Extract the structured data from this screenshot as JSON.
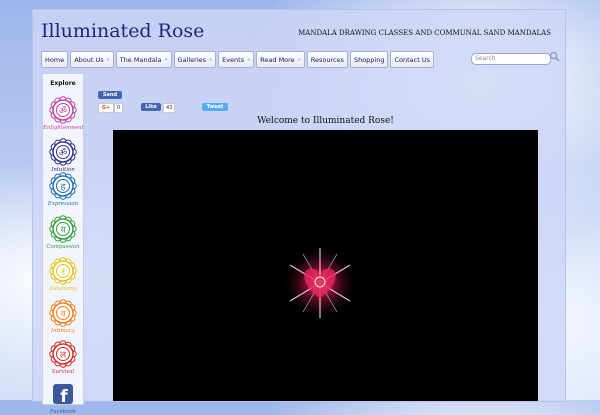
{
  "site": {
    "title": "Illuminated Rose",
    "tagline": "MANDALA DRAWING CLASSES AND COMMUNAL SAND MANDALAS"
  },
  "nav": {
    "items": [
      {
        "label": "Home",
        "has_dropdown": false
      },
      {
        "label": "About Us",
        "has_dropdown": true
      },
      {
        "label": "The Mandala",
        "has_dropdown": true
      },
      {
        "label": "Galleries",
        "has_dropdown": true
      },
      {
        "label": "Events",
        "has_dropdown": true
      },
      {
        "label": "Read More",
        "has_dropdown": true
      },
      {
        "label": "Resources",
        "has_dropdown": false
      },
      {
        "label": "Shopping",
        "has_dropdown": false
      },
      {
        "label": "Contact Us",
        "has_dropdown": false
      }
    ],
    "dropdown_glyph": "»"
  },
  "search": {
    "placeholder": "Search",
    "icon": "search-icon"
  },
  "sidebar": {
    "heading": "Explore",
    "items": [
      {
        "label": "Enlightenment",
        "color": "#c23fa8",
        "icon": "crown-chakra-icon",
        "glyph": "ॐ"
      },
      {
        "label": "Intuition",
        "color": "#2e3192",
        "icon": "third-eye-chakra-icon",
        "glyph": "ॐ"
      },
      {
        "label": "Expression",
        "color": "#1b6fb5",
        "icon": "throat-chakra-icon",
        "glyph": "ह"
      },
      {
        "label": "Compassion",
        "color": "#2f9e3c",
        "icon": "heart-chakra-icon",
        "glyph": "य"
      },
      {
        "label": "Autonomy",
        "color": "#e0c21a",
        "icon": "solar-plexus-chakra-icon",
        "glyph": "र"
      },
      {
        "label": "Intimacy",
        "color": "#ef7d1a",
        "icon": "sacral-chakra-icon",
        "glyph": "व"
      },
      {
        "label": "Survival",
        "color": "#d42a2a",
        "icon": "root-chakra-icon",
        "glyph": "ल"
      },
      {
        "label": "Facebook",
        "color": "#3b5998",
        "icon": "facebook-icon",
        "glyph": "f"
      }
    ]
  },
  "social": {
    "send_label": "Send",
    "gplus_label": "G+",
    "gplus_count": "0",
    "like_label": "Like",
    "like_count": "43",
    "tweet_label": "Tweet"
  },
  "main": {
    "welcome": "Welcome to Illuminated Rose!"
  },
  "colors": {
    "title": "#1d2a7a",
    "page_bg": "#cdd5f7",
    "video_bg": "#000000"
  }
}
